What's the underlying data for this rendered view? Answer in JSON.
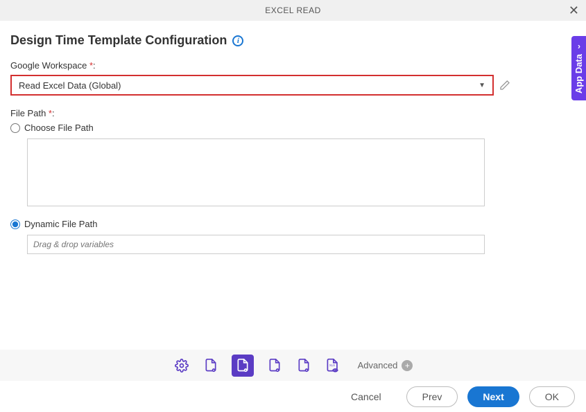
{
  "header": {
    "title": "EXCEL READ"
  },
  "section": {
    "title": "Design Time Template Configuration"
  },
  "fields": {
    "workspace": {
      "label": "Google Workspace ",
      "required": "*",
      "colon": ":",
      "value": "Read Excel Data (Global)"
    },
    "filepath": {
      "label": "File Path ",
      "required": "*",
      "colon": ":"
    },
    "choose": {
      "label": "Choose File Path"
    },
    "dynamic": {
      "label": "Dynamic File Path",
      "placeholder": "Drag & drop variables"
    }
  },
  "sidebar": {
    "app_data": "App Data"
  },
  "toolbar": {
    "advanced": "Advanced"
  },
  "footer": {
    "cancel": "Cancel",
    "prev": "Prev",
    "next": "Next",
    "ok": "OK"
  }
}
